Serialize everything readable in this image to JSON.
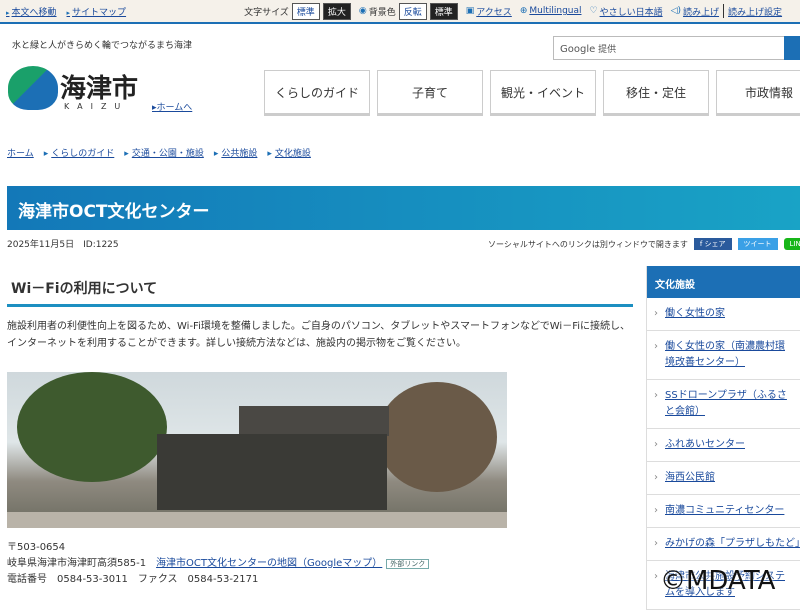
{
  "topbar": {
    "skip": "本文へ移動",
    "sitemap": "サイトマップ",
    "font_size": "文字サイズ",
    "font_std": "標準",
    "font_large": "拡大",
    "bg": "背景色",
    "bg_inv": "反転",
    "bg_std": "標準",
    "access": "アクセス",
    "multilingual": "Multilingual",
    "easy": "やさしい日本語",
    "read": "読み上げ",
    "read_settings": "読み上げ設定"
  },
  "header": {
    "tagline": "水と緑と人がきらめく輪でつながるまち海津",
    "search_brand": "Google",
    "search_suffix": "提供",
    "logo_name": "海津市",
    "logo_en": "KAIZU",
    "home": "ホームへ"
  },
  "nav": [
    "くらしのガイド",
    "子育て",
    "観光・イベント",
    "移住・定住",
    "市政情報"
  ],
  "breadcrumb": [
    "ホーム",
    "くらしのガイド",
    "交通・公園・施設",
    "公共施設",
    "文化施設"
  ],
  "page": {
    "title": "海津市OCT文化センター",
    "date": "2025年11月5日",
    "id": "ID:1225",
    "social_note": "ソーシャルサイトへのリンクは別ウィンドウで開きます",
    "share": "f シェア",
    "tweet": "ツイート",
    "line": "LINEで送る",
    "heading": "Wi－Fiの利用について",
    "intro": "施設利用者の利便性向上を図るため、Wi-Fi環境を整備しました。ご自身のパソコン、タブレットやスマートフォンなどでWi－Fiに接続し、インターネットを利用することができます。詳しい接続方法などは、施設内の掲示物をご覧ください。",
    "postal": "〒503-0654",
    "address": "岐阜県海津市海津町高須585-1",
    "map_link": "海津市OCT文化センターの地図（Googleマップ）",
    "external": "外部リンク",
    "phone": "電話番号　0584-53-3011　ファクス　0584-53-2171"
  },
  "sidebar": {
    "heading": "文化施設",
    "items": [
      "働く女性の家",
      "働く女性の家（南濃農村環境改善センター）",
      "SSドローンプラザ（ふるさと会館）",
      "ふれあいセンター",
      "海西公民館",
      "南濃コミュニティセンター",
      "みかげの森「プラザしもたど」",
      "海津市公共施設予約システムを導入します"
    ]
  },
  "watermark": "©MDATA",
  "colors": {
    "accent": "#1c6fb5",
    "title_gradient_end": "#19a3c6"
  }
}
